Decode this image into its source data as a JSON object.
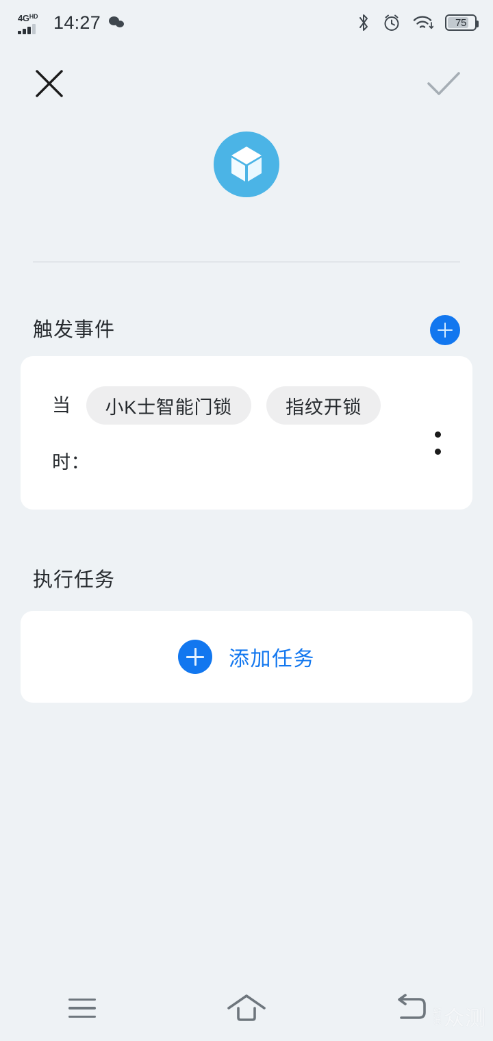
{
  "status_bar": {
    "network_type": "4G",
    "network_suffix": "HD",
    "time": "14:27",
    "wechat_icon": "wechat-icon",
    "bluetooth_icon": "bluetooth-icon",
    "alarm_icon": "alarm-clock-icon",
    "wifi_icon": "wifi-icon",
    "battery_percent": "75"
  },
  "app_bar": {
    "close_icon": "close-icon",
    "confirm_icon": "checkmark-icon"
  },
  "scene": {
    "icon": "cube-icon"
  },
  "trigger_section": {
    "title": "触发事件",
    "add_label": "+",
    "card": {
      "prefix": "当",
      "pills": [
        "小K士智能门锁",
        "指纹开锁"
      ],
      "suffix": "时：",
      "menu_icon": "more-vertical-icon"
    }
  },
  "task_section": {
    "title": "执行任务",
    "add_task_label": "添加任务"
  },
  "nav_bar": {
    "recents_icon": "menu-icon",
    "home_icon": "home-icon",
    "back_icon": "back-icon"
  },
  "watermark": {
    "small_text": "新浪",
    "big_text": "众测"
  },
  "colors": {
    "page_background": "#eef2f5",
    "card_background": "#ffffff",
    "accent_blue": "#1277ef",
    "scene_icon_blue": "#4bb4e6",
    "pill_background": "#eeeeef",
    "primary_text": "#262a2e"
  }
}
